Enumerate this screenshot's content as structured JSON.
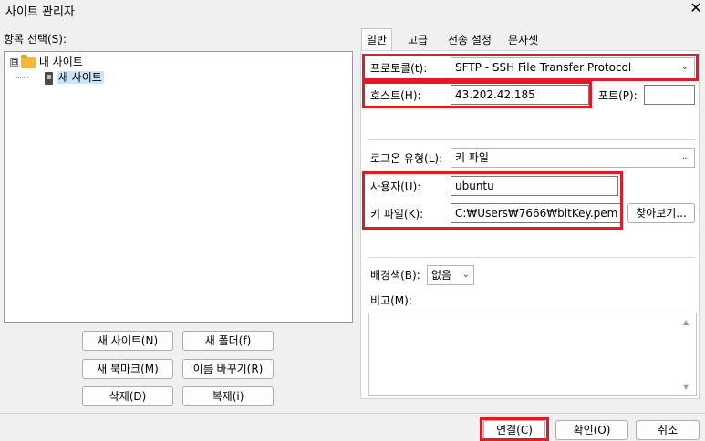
{
  "window": {
    "title": "사이트 관리자",
    "close_glyph": "✕"
  },
  "left": {
    "label": "항목 선택(S):",
    "tree": {
      "root": {
        "expander": "⊟",
        "label": "내 사이트"
      },
      "child": {
        "label": "새 사이트",
        "selected": true
      }
    },
    "buttons": {
      "new_site": "새 사이트(N)",
      "new_folder": "새 폴더(f)",
      "new_bookmark": "새 북마크(M)",
      "rename": "이름 바꾸기(R)",
      "delete": "삭제(D)",
      "duplicate": "복제(i)"
    }
  },
  "tabs": [
    "일반",
    "고급",
    "전송 설정",
    "문자셋"
  ],
  "general": {
    "protocol_label": "프로토콜(t):",
    "protocol_value": "SFTP - SSH File Transfer Protocol",
    "host_label": "호스트(H):",
    "host_value": "43.202.42.185",
    "port_label": "포트(P):",
    "port_value": "",
    "logon_label": "로그온 유형(L):",
    "logon_value": "키 파일",
    "user_label": "사용자(U):",
    "user_value": "ubuntu",
    "keyfile_label": "키 파일(K):",
    "keyfile_value": "C:₩Users₩7666₩bitKey.pem",
    "browse_button": "찾아보기...",
    "bgcolor_label": "배경색(B):",
    "bgcolor_value": "없음",
    "comments_label": "비고(M):",
    "comments_value": ""
  },
  "footer": {
    "connect": "연결(C)",
    "ok": "확인(O)",
    "cancel": "취소"
  },
  "highlight_color": "#e01b24"
}
